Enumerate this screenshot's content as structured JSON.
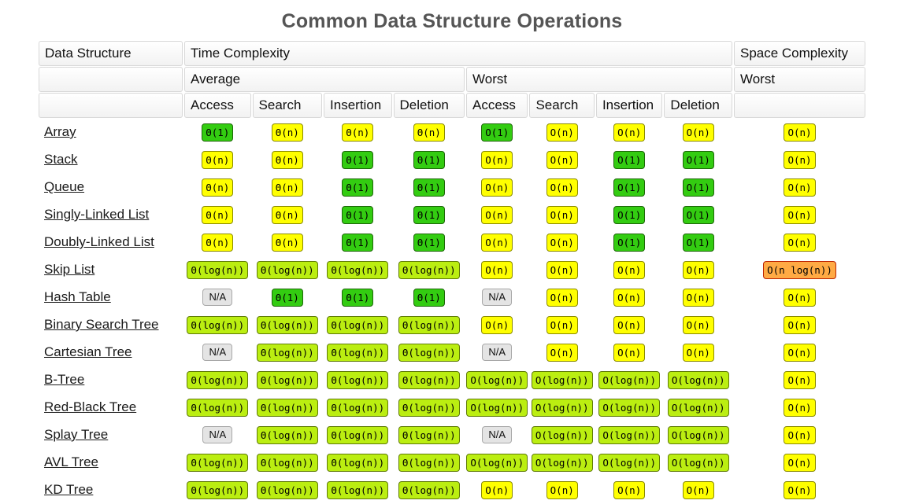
{
  "title": "Common Data Structure Operations",
  "header": {
    "row1": [
      {
        "label": "Data Structure",
        "colspan": 1,
        "blank": false
      },
      {
        "label": "Time Complexity",
        "colspan": 8,
        "blank": false
      },
      {
        "label": "Space Complexity",
        "colspan": 1,
        "blank": false
      }
    ],
    "row2": [
      {
        "label": "",
        "colspan": 1,
        "blank": true
      },
      {
        "label": "Average",
        "colspan": 4,
        "blank": false
      },
      {
        "label": "Worst",
        "colspan": 4,
        "blank": false
      },
      {
        "label": "Worst",
        "colspan": 1,
        "blank": false
      }
    ],
    "row3": [
      {
        "label": "",
        "colspan": 1,
        "blank": true
      },
      {
        "label": "Access",
        "colspan": 1,
        "blank": false
      },
      {
        "label": "Search",
        "colspan": 1,
        "blank": false
      },
      {
        "label": "Insertion",
        "colspan": 1,
        "blank": false
      },
      {
        "label": "Deletion",
        "colspan": 1,
        "blank": false
      },
      {
        "label": "Access",
        "colspan": 1,
        "blank": false
      },
      {
        "label": "Search",
        "colspan": 1,
        "blank": false
      },
      {
        "label": "Insertion",
        "colspan": 1,
        "blank": false
      },
      {
        "label": "Deletion",
        "colspan": 1,
        "blank": false
      },
      {
        "label": "",
        "colspan": 1,
        "blank": true
      }
    ]
  },
  "colors": {
    "green": "#33cc11",
    "chartreuse": "#bbee11",
    "yellow": "#ffff00",
    "orange": "#ffaa44",
    "na": "#e4e4e4",
    "title": "#555555"
  },
  "rows": [
    {
      "name": "Array",
      "cells": [
        {
          "text": "Θ(1)",
          "color": "green"
        },
        {
          "text": "Θ(n)",
          "color": "yellow"
        },
        {
          "text": "Θ(n)",
          "color": "yellow"
        },
        {
          "text": "Θ(n)",
          "color": "yellow"
        },
        {
          "text": "O(1)",
          "color": "green"
        },
        {
          "text": "O(n)",
          "color": "yellow"
        },
        {
          "text": "O(n)",
          "color": "yellow"
        },
        {
          "text": "O(n)",
          "color": "yellow"
        },
        {
          "text": "O(n)",
          "color": "yellow"
        }
      ]
    },
    {
      "name": "Stack",
      "cells": [
        {
          "text": "Θ(n)",
          "color": "yellow"
        },
        {
          "text": "Θ(n)",
          "color": "yellow"
        },
        {
          "text": "Θ(1)",
          "color": "green"
        },
        {
          "text": "Θ(1)",
          "color": "green"
        },
        {
          "text": "O(n)",
          "color": "yellow"
        },
        {
          "text": "O(n)",
          "color": "yellow"
        },
        {
          "text": "O(1)",
          "color": "green"
        },
        {
          "text": "O(1)",
          "color": "green"
        },
        {
          "text": "O(n)",
          "color": "yellow"
        }
      ]
    },
    {
      "name": "Queue",
      "cells": [
        {
          "text": "Θ(n)",
          "color": "yellow"
        },
        {
          "text": "Θ(n)",
          "color": "yellow"
        },
        {
          "text": "Θ(1)",
          "color": "green"
        },
        {
          "text": "Θ(1)",
          "color": "green"
        },
        {
          "text": "O(n)",
          "color": "yellow"
        },
        {
          "text": "O(n)",
          "color": "yellow"
        },
        {
          "text": "O(1)",
          "color": "green"
        },
        {
          "text": "O(1)",
          "color": "green"
        },
        {
          "text": "O(n)",
          "color": "yellow"
        }
      ]
    },
    {
      "name": "Singly-Linked List",
      "cells": [
        {
          "text": "Θ(n)",
          "color": "yellow"
        },
        {
          "text": "Θ(n)",
          "color": "yellow"
        },
        {
          "text": "Θ(1)",
          "color": "green"
        },
        {
          "text": "Θ(1)",
          "color": "green"
        },
        {
          "text": "O(n)",
          "color": "yellow"
        },
        {
          "text": "O(n)",
          "color": "yellow"
        },
        {
          "text": "O(1)",
          "color": "green"
        },
        {
          "text": "O(1)",
          "color": "green"
        },
        {
          "text": "O(n)",
          "color": "yellow"
        }
      ]
    },
    {
      "name": "Doubly-Linked List",
      "cells": [
        {
          "text": "Θ(n)",
          "color": "yellow"
        },
        {
          "text": "Θ(n)",
          "color": "yellow"
        },
        {
          "text": "Θ(1)",
          "color": "green"
        },
        {
          "text": "Θ(1)",
          "color": "green"
        },
        {
          "text": "O(n)",
          "color": "yellow"
        },
        {
          "text": "O(n)",
          "color": "yellow"
        },
        {
          "text": "O(1)",
          "color": "green"
        },
        {
          "text": "O(1)",
          "color": "green"
        },
        {
          "text": "O(n)",
          "color": "yellow"
        }
      ]
    },
    {
      "name": "Skip List",
      "cells": [
        {
          "text": "Θ(log(n))",
          "color": "chartreuse"
        },
        {
          "text": "Θ(log(n))",
          "color": "chartreuse"
        },
        {
          "text": "Θ(log(n))",
          "color": "chartreuse"
        },
        {
          "text": "Θ(log(n))",
          "color": "chartreuse"
        },
        {
          "text": "O(n)",
          "color": "yellow"
        },
        {
          "text": "O(n)",
          "color": "yellow"
        },
        {
          "text": "O(n)",
          "color": "yellow"
        },
        {
          "text": "O(n)",
          "color": "yellow"
        },
        {
          "text": "O(n log(n))",
          "color": "orange"
        }
      ]
    },
    {
      "name": "Hash Table",
      "cells": [
        {
          "text": "N/A",
          "color": "na"
        },
        {
          "text": "Θ(1)",
          "color": "green"
        },
        {
          "text": "Θ(1)",
          "color": "green"
        },
        {
          "text": "Θ(1)",
          "color": "green"
        },
        {
          "text": "N/A",
          "color": "na"
        },
        {
          "text": "O(n)",
          "color": "yellow"
        },
        {
          "text": "O(n)",
          "color": "yellow"
        },
        {
          "text": "O(n)",
          "color": "yellow"
        },
        {
          "text": "O(n)",
          "color": "yellow"
        }
      ]
    },
    {
      "name": "Binary Search Tree",
      "cells": [
        {
          "text": "Θ(log(n))",
          "color": "chartreuse"
        },
        {
          "text": "Θ(log(n))",
          "color": "chartreuse"
        },
        {
          "text": "Θ(log(n))",
          "color": "chartreuse"
        },
        {
          "text": "Θ(log(n))",
          "color": "chartreuse"
        },
        {
          "text": "O(n)",
          "color": "yellow"
        },
        {
          "text": "O(n)",
          "color": "yellow"
        },
        {
          "text": "O(n)",
          "color": "yellow"
        },
        {
          "text": "O(n)",
          "color": "yellow"
        },
        {
          "text": "O(n)",
          "color": "yellow"
        }
      ]
    },
    {
      "name": "Cartesian Tree",
      "cells": [
        {
          "text": "N/A",
          "color": "na"
        },
        {
          "text": "Θ(log(n))",
          "color": "chartreuse"
        },
        {
          "text": "Θ(log(n))",
          "color": "chartreuse"
        },
        {
          "text": "Θ(log(n))",
          "color": "chartreuse"
        },
        {
          "text": "N/A",
          "color": "na"
        },
        {
          "text": "O(n)",
          "color": "yellow"
        },
        {
          "text": "O(n)",
          "color": "yellow"
        },
        {
          "text": "O(n)",
          "color": "yellow"
        },
        {
          "text": "O(n)",
          "color": "yellow"
        }
      ]
    },
    {
      "name": "B-Tree",
      "cells": [
        {
          "text": "Θ(log(n))",
          "color": "chartreuse"
        },
        {
          "text": "Θ(log(n))",
          "color": "chartreuse"
        },
        {
          "text": "Θ(log(n))",
          "color": "chartreuse"
        },
        {
          "text": "Θ(log(n))",
          "color": "chartreuse"
        },
        {
          "text": "O(log(n))",
          "color": "chartreuse"
        },
        {
          "text": "O(log(n))",
          "color": "chartreuse"
        },
        {
          "text": "O(log(n))",
          "color": "chartreuse"
        },
        {
          "text": "O(log(n))",
          "color": "chartreuse"
        },
        {
          "text": "O(n)",
          "color": "yellow"
        }
      ]
    },
    {
      "name": "Red-Black Tree",
      "cells": [
        {
          "text": "Θ(log(n))",
          "color": "chartreuse"
        },
        {
          "text": "Θ(log(n))",
          "color": "chartreuse"
        },
        {
          "text": "Θ(log(n))",
          "color": "chartreuse"
        },
        {
          "text": "Θ(log(n))",
          "color": "chartreuse"
        },
        {
          "text": "O(log(n))",
          "color": "chartreuse"
        },
        {
          "text": "O(log(n))",
          "color": "chartreuse"
        },
        {
          "text": "O(log(n))",
          "color": "chartreuse"
        },
        {
          "text": "O(log(n))",
          "color": "chartreuse"
        },
        {
          "text": "O(n)",
          "color": "yellow"
        }
      ]
    },
    {
      "name": "Splay Tree",
      "cells": [
        {
          "text": "N/A",
          "color": "na"
        },
        {
          "text": "Θ(log(n))",
          "color": "chartreuse"
        },
        {
          "text": "Θ(log(n))",
          "color": "chartreuse"
        },
        {
          "text": "Θ(log(n))",
          "color": "chartreuse"
        },
        {
          "text": "N/A",
          "color": "na"
        },
        {
          "text": "O(log(n))",
          "color": "chartreuse"
        },
        {
          "text": "O(log(n))",
          "color": "chartreuse"
        },
        {
          "text": "O(log(n))",
          "color": "chartreuse"
        },
        {
          "text": "O(n)",
          "color": "yellow"
        }
      ]
    },
    {
      "name": "AVL Tree",
      "cells": [
        {
          "text": "Θ(log(n))",
          "color": "chartreuse"
        },
        {
          "text": "Θ(log(n))",
          "color": "chartreuse"
        },
        {
          "text": "Θ(log(n))",
          "color": "chartreuse"
        },
        {
          "text": "Θ(log(n))",
          "color": "chartreuse"
        },
        {
          "text": "O(log(n))",
          "color": "chartreuse"
        },
        {
          "text": "O(log(n))",
          "color": "chartreuse"
        },
        {
          "text": "O(log(n))",
          "color": "chartreuse"
        },
        {
          "text": "O(log(n))",
          "color": "chartreuse"
        },
        {
          "text": "O(n)",
          "color": "yellow"
        }
      ]
    },
    {
      "name": "KD Tree",
      "cells": [
        {
          "text": "Θ(log(n))",
          "color": "chartreuse"
        },
        {
          "text": "Θ(log(n))",
          "color": "chartreuse"
        },
        {
          "text": "Θ(log(n))",
          "color": "chartreuse"
        },
        {
          "text": "Θ(log(n))",
          "color": "chartreuse"
        },
        {
          "text": "O(n)",
          "color": "yellow"
        },
        {
          "text": "O(n)",
          "color": "yellow"
        },
        {
          "text": "O(n)",
          "color": "yellow"
        },
        {
          "text": "O(n)",
          "color": "yellow"
        },
        {
          "text": "O(n)",
          "color": "yellow"
        }
      ]
    }
  ]
}
